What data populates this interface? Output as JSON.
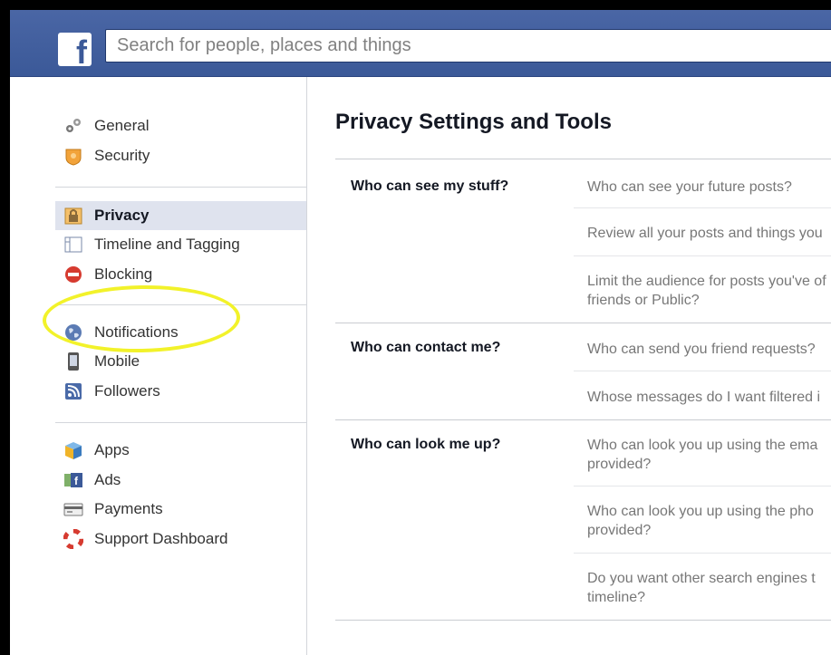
{
  "search": {
    "placeholder": "Search for people, places and things"
  },
  "brand": {
    "logo_letter": "f"
  },
  "sidebar": {
    "groups": [
      {
        "items": [
          {
            "label": "General",
            "icon": "gears-icon"
          },
          {
            "label": "Security",
            "icon": "badge-icon"
          }
        ]
      },
      {
        "items": [
          {
            "label": "Privacy",
            "icon": "lock-icon",
            "active": true
          },
          {
            "label": "Timeline and Tagging",
            "icon": "timeline-icon"
          },
          {
            "label": "Blocking",
            "icon": "block-icon"
          }
        ]
      },
      {
        "items": [
          {
            "label": "Notifications",
            "icon": "globe-icon"
          },
          {
            "label": "Mobile",
            "icon": "phone-icon"
          },
          {
            "label": "Followers",
            "icon": "rss-icon"
          }
        ]
      },
      {
        "items": [
          {
            "label": "Apps",
            "icon": "cube-icon"
          },
          {
            "label": "Ads",
            "icon": "ads-icon"
          },
          {
            "label": "Payments",
            "icon": "card-icon"
          },
          {
            "label": "Support Dashboard",
            "icon": "lifebuoy-icon"
          }
        ]
      }
    ]
  },
  "main": {
    "title": "Privacy Settings and Tools",
    "sections": [
      {
        "label": "Who can see my stuff?",
        "questions": [
          "Who can see your future posts?",
          "Review all your posts and things you",
          "Limit the audience for posts you've of friends or Public?"
        ]
      },
      {
        "label": "Who can contact me?",
        "questions": [
          "Who can send you friend requests?",
          "Whose messages do I want filtered i"
        ]
      },
      {
        "label": "Who can look me up?",
        "questions": [
          "Who can look you up using the ema provided?",
          "Who can look you up using the pho provided?",
          "Do you want other search engines t timeline?"
        ]
      }
    ]
  },
  "colors": {
    "topbar": "#3b5998",
    "highlight": "#f2f22a",
    "active_bg": "#dfe3ee"
  }
}
